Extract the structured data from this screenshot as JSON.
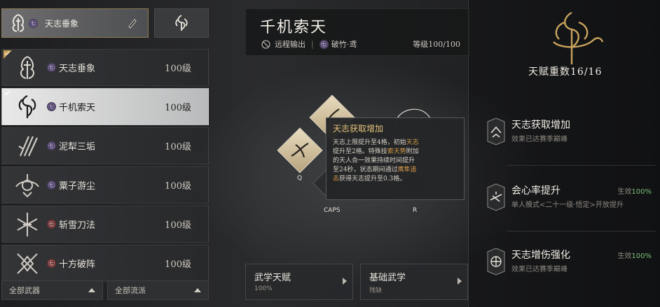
{
  "top_bar": {
    "selected_tab_label": "天志垂象",
    "selected_tab_tag": "㊆"
  },
  "weapons": [
    {
      "tag": "㊆",
      "name": "天志垂象",
      "level": "100级",
      "tag_color": "purple"
    },
    {
      "tag": "㊆",
      "name": "千机索天",
      "level": "100级",
      "tag_color": "purple"
    },
    {
      "tag": "㊆",
      "name": "泥犁三垢",
      "level": "100级",
      "tag_color": "purple"
    },
    {
      "tag": "㊆",
      "name": "粟子游尘",
      "level": "100级",
      "tag_color": "purple"
    },
    {
      "tag": "㊆",
      "name": "斩雪刀法",
      "level": "100级",
      "tag_color": "red"
    },
    {
      "tag": "㊆",
      "name": "十方破阵",
      "level": "100级",
      "tag_color": "red"
    }
  ],
  "filters": [
    "全部武器",
    "全部流派"
  ],
  "header": {
    "title": "千机索天",
    "type": "远程输出",
    "tag": "破竹·鸢",
    "grade": "等级100/100"
  },
  "keys": [
    "Q",
    "CAPS",
    "R"
  ],
  "tooltip": {
    "title": "天志获取增加",
    "l1a": "天志上限提升至4格，初始",
    "l1b": "天志",
    "l2": "提升至2格。特殊技",
    "l2b": "索天势",
    "l2c": "附加",
    "l3": "的天人合一效果持续时间提升",
    "l4": "至24秒，状态期间通过",
    "l4b": "鹰隼追",
    "l5a": "击",
    "l5b": "获得天志提升至0.3格。"
  },
  "cards": [
    {
      "name": "武学天赋",
      "sub": "100%"
    },
    {
      "name": "基础武学",
      "sub": "残缺"
    }
  ],
  "right": {
    "count": "天赋重数16/16",
    "talents": [
      {
        "name": "天志获取增加",
        "desc": "效果已达赛季巅峰",
        "effect_label": "",
        "effect_value": ""
      },
      {
        "name": "会心率提升",
        "desc": "单人模式<二十一级·悟定>开放提升",
        "effect_label": "生效",
        "effect_value": "100%"
      },
      {
        "name": "天志增伤强化",
        "desc": "效果已达赛季巅峰",
        "effect_label": "生效",
        "effect_value": "100%"
      }
    ]
  },
  "colors": {
    "accent_gold": "#e3c27d",
    "effect_green": "#7cc17a",
    "tag_purple": "#4c3f63",
    "tag_red": "#6a3131"
  }
}
